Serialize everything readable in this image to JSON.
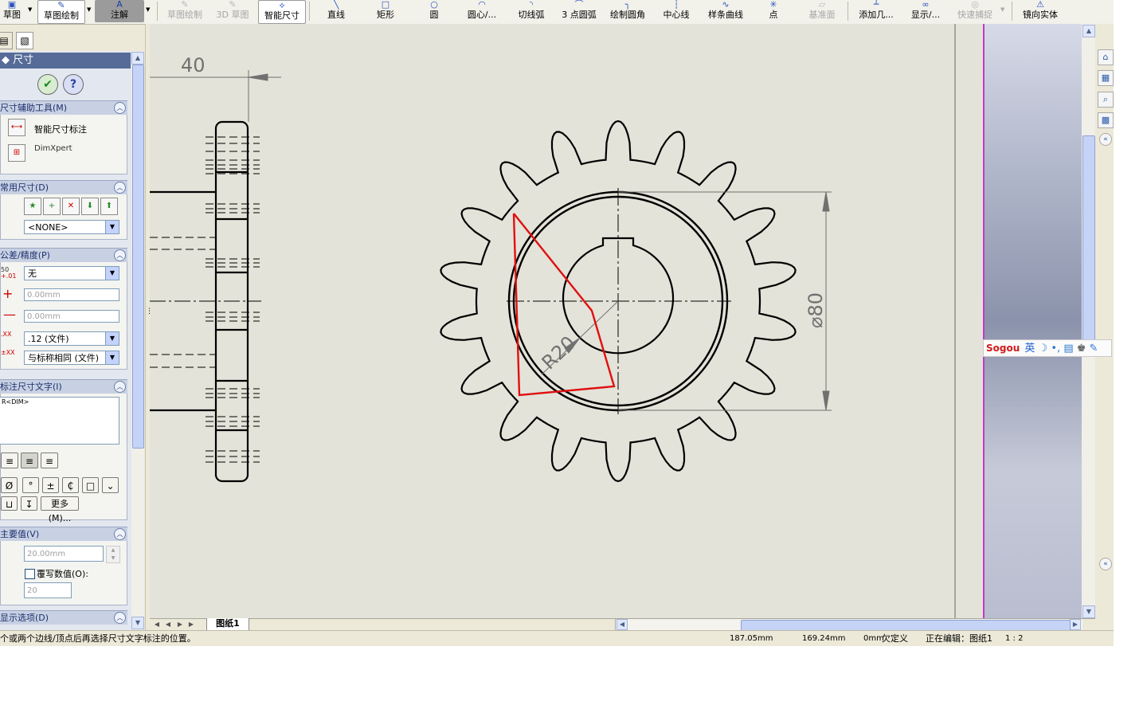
{
  "toolbar": {
    "items": [
      {
        "label": "草图",
        "icon": "sketch-icon",
        "state": "normal"
      },
      {
        "label": "草图绘制",
        "icon": "sketch-draw-icon",
        "state": "active"
      },
      {
        "label": "注解",
        "icon": "annotation-icon",
        "state": "dark"
      },
      {
        "label": "草图绘制",
        "icon": "sketch-icon",
        "state": "disabled"
      },
      {
        "label": "3D 草图",
        "icon": "3d-sketch-icon",
        "state": "disabled"
      },
      {
        "label": "智能尺寸",
        "icon": "smart-dimension-icon",
        "state": "active"
      },
      {
        "label": "直线",
        "icon": "line-icon",
        "state": "normal"
      },
      {
        "label": "矩形",
        "icon": "rectangle-icon",
        "state": "normal"
      },
      {
        "label": "圆",
        "icon": "circle-icon",
        "state": "normal"
      },
      {
        "label": "圆心/...",
        "icon": "center-arc-icon",
        "state": "normal"
      },
      {
        "label": "切线弧",
        "icon": "tangent-arc-icon",
        "state": "normal"
      },
      {
        "label": "3 点圆弧",
        "icon": "3point-arc-icon",
        "state": "normal"
      },
      {
        "label": "绘制圆角",
        "icon": "fillet-icon",
        "state": "normal"
      },
      {
        "label": "中心线",
        "icon": "centerline-icon",
        "state": "normal"
      },
      {
        "label": "样条曲线",
        "icon": "spline-icon",
        "state": "normal"
      },
      {
        "label": "点",
        "icon": "point-icon",
        "state": "normal"
      },
      {
        "label": "基准面",
        "icon": "plane-icon",
        "state": "disabled"
      },
      {
        "label": "添加几...",
        "icon": "add-relation-icon",
        "state": "normal"
      },
      {
        "label": "显示/...",
        "icon": "display-icon",
        "state": "normal"
      },
      {
        "label": "快速捕捉",
        "icon": "quick-snap-icon",
        "state": "disabled"
      },
      {
        "label": "镜向实体",
        "icon": "mirror-icon",
        "state": "normal"
      }
    ]
  },
  "panel": {
    "title": "尺寸",
    "ok_icon": "check-icon",
    "help_icon": "help-icon",
    "sections": {
      "dim_tools": {
        "title": "尺寸辅助工具(M)",
        "items": [
          "智能尺寸标注",
          "DimXpert"
        ]
      },
      "common": {
        "title": "常用尺寸(D)",
        "select": "<NONE>"
      },
      "tolerance": {
        "title": "公差/精度(P)",
        "type": "无",
        "plus": "0.00mm",
        "minus": "0.00mm",
        "precision": ".12 (文件)",
        "tol_precision": "与标称相同 (文件)",
        "icon_50": "50",
        "icon_01": "+.01",
        "icon_m01": "-.01"
      },
      "text": {
        "title": "标注尺寸文字(I)",
        "value": "R<DIM>",
        "more": "更多(M)..."
      },
      "primary": {
        "title": "主要值(V)",
        "value": "20.00mm",
        "override_label": "覆写数值(O):",
        "override_value": "20"
      },
      "display": {
        "title": "显示选项(D)"
      }
    }
  },
  "drawing": {
    "dim_top": "40",
    "dim_radius": "R20",
    "dim_diameter": "⌀80",
    "colors": {
      "line": "#000000",
      "dim": "#707070",
      "sketch": "#e01010"
    }
  },
  "sheet": {
    "tab": "图纸1"
  },
  "status": {
    "hint": "个或两个边线/顶点后再选择尺寸文字标注的位置。",
    "x": "187.05mm",
    "y": "169.24mm",
    "z": "0mm",
    "def": "欠定义",
    "editing": "正在编辑：图纸1",
    "scale": "1 : 2"
  },
  "ime": {
    "brand": "Sogou",
    "mode": "英"
  }
}
